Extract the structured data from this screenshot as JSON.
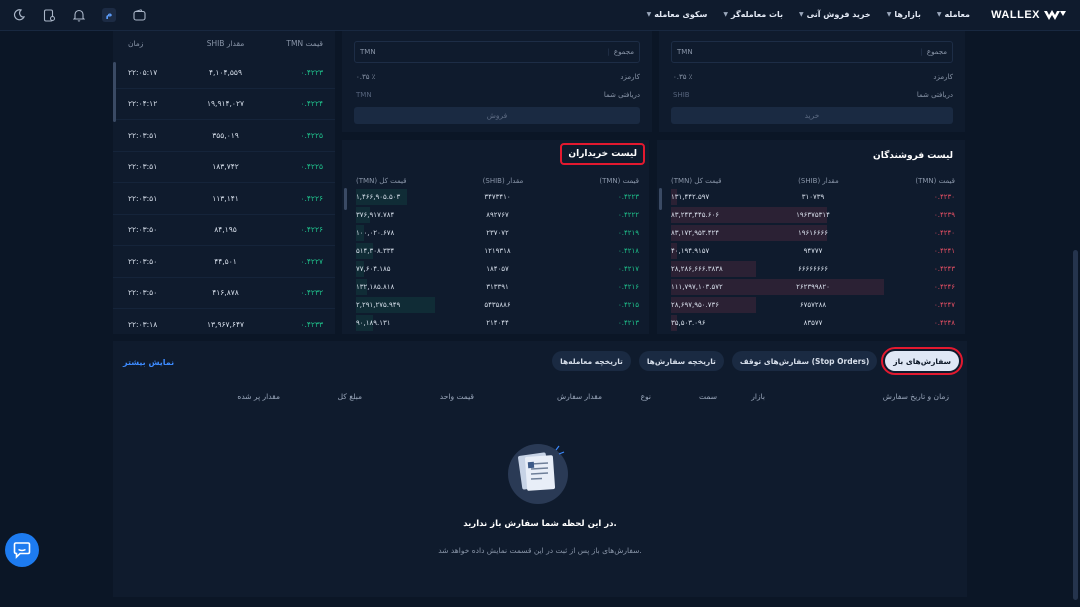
{
  "header": {
    "brand": "WALLEX",
    "nav": [
      "معامله",
      "بازارها",
      "خرید فروش آنی",
      "بات معامله‌گر",
      "سکوی معامله"
    ],
    "icons": [
      "moon-icon",
      "device-icon",
      "bell-icon",
      "profile-badge",
      "wallet-icon"
    ],
    "profile_badge": "م"
  },
  "trades": {
    "columns": [
      "قیمت TMN",
      "مقدار SHIB",
      "زمان"
    ],
    "rows": [
      {
        "price": "۰.۴۲۲۳",
        "amount": "۴,۱۰۴,۵۵۹",
        "time": "۲۲:۰۵:۱۷"
      },
      {
        "price": "۰.۴۲۲۴",
        "amount": "۱۹,۹۱۴,۰۲۷",
        "time": "۲۲:۰۴:۱۲"
      },
      {
        "price": "۰.۴۲۲۵",
        "amount": "۳۵۵,۰۱۹",
        "time": "۲۲:۰۳:۵۱"
      },
      {
        "price": "۰.۴۲۲۵",
        "amount": "۱۸۳,۷۴۲",
        "time": "۲۲:۰۳:۵۱"
      },
      {
        "price": "۰.۴۲۲۶",
        "amount": "۱۱۳,۱۴۱",
        "time": "۲۲:۰۳:۵۱"
      },
      {
        "price": "۰.۴۲۲۶",
        "amount": "۸۴,۱۹۵",
        "time": "۲۲:۰۳:۵۰"
      },
      {
        "price": "۰.۴۲۲۷",
        "amount": "۴۴,۵۰۱",
        "time": "۲۲:۰۳:۵۰"
      },
      {
        "price": "۰.۴۲۳۲",
        "amount": "۴۱۶,۸۷۸",
        "time": "۲۲:۰۳:۵۰"
      },
      {
        "price": "۰.۴۲۳۳",
        "amount": "۱۳,۹۶۷,۶۴۷",
        "time": "۲۲:۰۳:۱۸"
      }
    ]
  },
  "sell_form": {
    "total_label": "مجموع",
    "total_unit": "TMN",
    "fee_label": "کارمزد",
    "fee_value": "۰.۳۵ ٪",
    "receive_label": "دریافتی شما",
    "receive_unit": "TMN",
    "button": "فروش"
  },
  "buy_form": {
    "total_label": "مجموع",
    "total_unit": "TMN",
    "fee_label": "کارمزد",
    "fee_value": "۰.۳۵ ٪",
    "receive_label": "دریافتی شما",
    "receive_unit": "SHIB",
    "button": "خرید"
  },
  "buy_book": {
    "title": "لیست خریداران",
    "columns": [
      "قیمت (TMN)",
      "مقدار (SHIB)",
      "قیمت کل (TMN)"
    ],
    "rows": [
      {
        "price": "۰.۴۲۲۳",
        "amount": "۳۴۷۳۴۱۰",
        "total": "۱,۴۶۶,۹۰۵.۵۰۳"
      },
      {
        "price": "۰.۴۲۲۲",
        "amount": "۸۹۲۷۶۷",
        "total": "۳۷۶,۹۱۷.۷۸۴"
      },
      {
        "price": "۰.۴۲۱۹",
        "amount": "۲۳۷۰۷۲",
        "total": "۱۰۰,۰۲۰.۶۷۸"
      },
      {
        "price": "۰.۴۲۱۸",
        "amount": "۱۲۱۹۳۱۸",
        "total": "۵۱۴,۳۰۸.۳۳۴"
      },
      {
        "price": "۰.۴۲۱۷",
        "amount": "۱۸۴۰۵۷",
        "total": "۷۷,۶۰۴.۱۸۵"
      },
      {
        "price": "۰.۴۲۱۶",
        "amount": "۳۱۳۳۹۱",
        "total": "۱۳۲,۱۸۵.۸۱۸"
      },
      {
        "price": "۰.۴۲۱۵",
        "amount": "۵۴۳۵۸۸۶",
        "total": "۲,۲۹۱,۲۷۵.۹۴۹"
      },
      {
        "price": "۰.۴۲۱۳",
        "amount": "۲۱۴۰۴۴",
        "total": "۹۰,۱۸۹.۱۳۱"
      }
    ],
    "depth": [
      0.18,
      0.05,
      0.03,
      0.06,
      0.03,
      0.04,
      0.28,
      0.06
    ]
  },
  "sell_book": {
    "title": "لیست فروشندگان",
    "columns": [
      "قیمت (TMN)",
      "مقدار (SHIB)",
      "قیمت کل (TMN)"
    ],
    "rows": [
      {
        "price": "۰.۴۲۳۰",
        "amount": "۳۱۰۷۳۹",
        "total": "۱۳۱,۴۴۲.۵۹۷"
      },
      {
        "price": "۰.۴۲۳۹",
        "amount": "۱۹۶۳۷۵۳۱۴",
        "total": "۸۳,۲۴۳,۴۴۵.۶۰۶"
      },
      {
        "price": "۰.۴۲۴۰",
        "amount": "۱۹۶۱۶۶۶۶",
        "total": "۸۳,۱۷۲,۹۵۳.۴۲۴"
      },
      {
        "price": "۰.۴۲۴۱",
        "amount": "۹۴۷۷۷",
        "total": "۴۰,۱۹۴.۹۱۵۷"
      },
      {
        "price": "۰.۴۲۴۳",
        "amount": "۶۶۶۶۶۶۶۶",
        "total": "۲۸,۲۸۶,۶۶۶.۳۸۳۸"
      },
      {
        "price": "۰.۴۲۴۶",
        "amount": "۲۶۲۳۹۹۸۲۰",
        "total": "۱۱۱,۷۹۷,۱۰۳.۵۷۲"
      },
      {
        "price": "۰.۴۲۴۷",
        "amount": "۶۷۵۷۲۸۸",
        "total": "۲۸,۶۹۷,۹۵۰.۷۳۶"
      },
      {
        "price": "۰.۴۲۴۸",
        "amount": "۸۳۵۷۷",
        "total": "۳۵,۵۰۳.۰۹۶"
      }
    ],
    "depth": [
      0.02,
      0.55,
      0.55,
      0.02,
      0.3,
      0.75,
      0.3,
      0.02
    ]
  },
  "orders": {
    "tabs": [
      "سفارش‌های باز",
      "سفارش‌های توقف (Stop Orders)",
      "تاریخچه سفارش‌ها",
      "تاریخچه معامله‌ها"
    ],
    "more_link": "نمایش بیشتر",
    "columns": [
      "زمان و تاریخ سفارش",
      "بازار",
      "سمت",
      "نوع",
      "مقدار سفارش",
      "قیمت واحد",
      "مبلغ کل",
      "مقدار پر شده"
    ],
    "empty_title": "در این لحظه شما سفارش باز ندارید.",
    "empty_sub": "سفارش‌های باز پس از ثبت در این قسمت نمایش داده خواهد شد."
  },
  "colors": {
    "buy": "#1fc08b",
    "sell": "#e65064",
    "accent": "#3d8bff",
    "highlight": "#e3192f"
  }
}
